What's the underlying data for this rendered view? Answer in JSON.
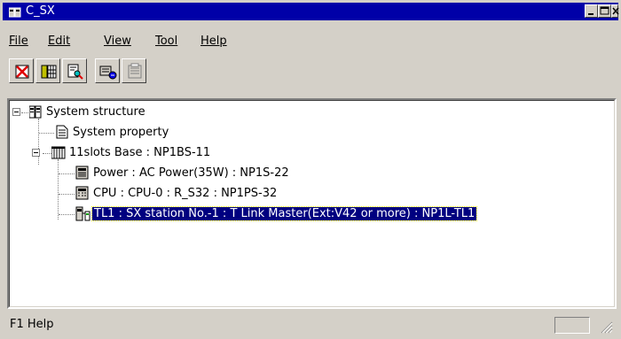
{
  "window": {
    "title": "C_SX"
  },
  "menu": {
    "file": "File",
    "edit": "Edit",
    "view": "View",
    "tool": "Tool",
    "help": "Help"
  },
  "toolbar": {
    "buttons": [
      "delete-icon",
      "module-icon",
      "search-icon",
      "transfer-icon",
      "print-icon"
    ]
  },
  "tree": {
    "root": "System structure",
    "property": "System property",
    "base": "11slots Base : NP1BS-11",
    "power": "Power : AC Power(35W) : NP1S-22",
    "cpu": "CPU : CPU-0 : R_S32 : NP1PS-32",
    "tl1": "TL1 : SX station No.-1 : T Link Master(Ext:V42 or more) : NP1L-TL1"
  },
  "status": {
    "text": "F1 Help"
  },
  "colors": {
    "titlebar": "#0000a8",
    "selection": "#000080",
    "face": "#d4d0c8"
  }
}
